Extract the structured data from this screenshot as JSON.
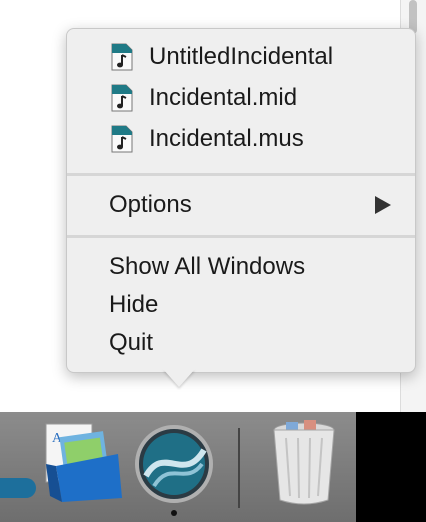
{
  "menu": {
    "documents": [
      {
        "label": "UntitledIncidental",
        "icon": "music-document-icon"
      },
      {
        "label": "Incidental.mid",
        "icon": "music-document-icon"
      },
      {
        "label": "Incidental.mus",
        "icon": "music-document-icon"
      }
    ],
    "options_label": "Options",
    "show_all_windows_label": "Show All Windows",
    "hide_label": "Hide",
    "quit_label": "Quit"
  },
  "dock": {
    "apps": [
      {
        "name": "preview-app-icon"
      },
      {
        "name": "finale-app-icon"
      },
      {
        "name": "trash-icon"
      }
    ]
  }
}
